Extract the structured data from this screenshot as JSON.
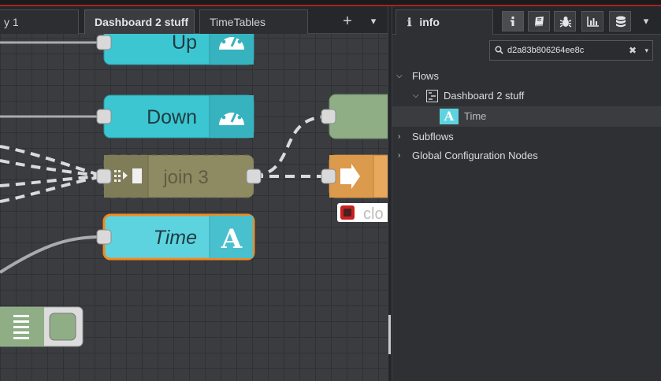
{
  "tabs": [
    {
      "label": "y 1"
    },
    {
      "label": "Dashboard 2 stuff"
    },
    {
      "label": "TimeTables"
    }
  ],
  "tabbar": {
    "add_label": "+",
    "menu_label": "▾"
  },
  "nodes": {
    "up": {
      "label": "Up",
      "color": "#3cc6d2"
    },
    "down": {
      "label": "Down",
      "color": "#3cc6d2"
    },
    "join": {
      "label": "join 3",
      "color": "#a6a26f"
    },
    "time": {
      "label": "Time",
      "color": "#5dd3e0",
      "selected_border": "#f28a1f"
    },
    "clock_label": "clo"
  },
  "sidebar": {
    "tab_label": "info",
    "tab_icon": "info-icon",
    "buttons": [
      "info-icon",
      "book-icon",
      "bug-icon",
      "chart-icon",
      "database-icon"
    ],
    "search_value": "d2a83b806264ee8c",
    "search_clear": "✖",
    "search_caret": "▾",
    "tree": {
      "flows": "Flows",
      "flow_item": "Dashboard 2 stuff",
      "node_item": "Time",
      "subflows": "Subflows",
      "global_config": "Global Configuration Nodes"
    }
  }
}
